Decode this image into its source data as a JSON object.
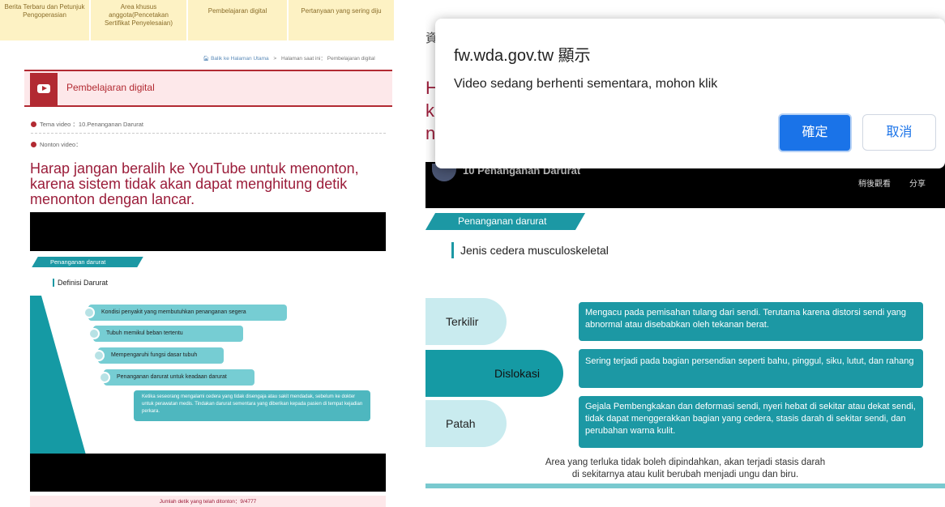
{
  "nav": [
    "Berita Terbaru dan Petunjuk Pengoperasian",
    "Area khusus anggota(Pencetakan Sertifikat Penyelesaian)",
    "Pembelajaran digital",
    "Pertanyaan yang sering diju"
  ],
  "breadcrumb": {
    "home": "Balik ke Halaman Utama",
    "separator": ">",
    "current": "Halaman saat ini： Pembelajaran digital"
  },
  "header_title": "Pembelajaran digital",
  "theme_label": "Tema video ：10.Penanganan Darurat",
  "watch_label": "Nonton video：",
  "warning": "Harap jangan beralih ke YouTube untuk menonton, karena sistem tidak akan dapat menghitung detik menonton dengan lancar.",
  "left_slide": {
    "banner": "Penanganan darurat",
    "heading": "Definisi Darurat",
    "items": [
      "Kondisi penyakit yang membutuhkan penanganan segera",
      "Tubuh memikul beban tertentu",
      "Mempengaruhi fungsi dasar tubuh",
      "Penanganan darurat untuk keadaan darurat"
    ],
    "detail": "Ketika seseorang mengalami cedera yang tidak disengaja atau sakit mendadak, sebelum ke dokter untuk perawatan medis. Tindakan darurat sementara yang diberikan kepada pasien di tempat kejadian perkara."
  },
  "seconds_counter": "Jumlah detik yang telah ditonton：9/4777",
  "right_bg_letters": [
    "H",
    "k",
    "n"
  ],
  "right_bg_top_char": "資",
  "youtube": {
    "title": "10 Penanganan Darurat",
    "watch_later": "稍後觀看",
    "share": "分享"
  },
  "right_slide": {
    "banner": "Penanganan darurat",
    "heading": "Jenis cedera musculoskeletal",
    "rows": [
      {
        "label": "Terkilir",
        "text": "Mengacu pada pemisahan tulang dari sendi.  Terutama karena distorsi sendi yang abnormal atau disebabkan oleh tekanan berat."
      },
      {
        "label": "Dislokasi",
        "text": "Sering terjadi pada bagian persendian seperti bahu, pinggul, siku, lutut, dan rahang"
      },
      {
        "label": "Patah",
        "text": "Gejala Pembengkakan dan deformasi sendi, nyeri hebat di sekitar atau dekat sendi, tidak dapat menggerakkan bagian yang cedera, stasis darah di sekitar sendi, dan perubahan warna kulit."
      }
    ],
    "note_line1": "Area yang terluka tidak boleh dipindahkan, akan terjadi stasis darah",
    "note_line2": "di sekitarnya atau kulit berubah menjadi ungu dan biru."
  },
  "dialog": {
    "title": "fw.wda.gov.tw 顯示",
    "message": "Video sedang berhenti sementara, mohon klik",
    "ok": "確定",
    "cancel": "取消"
  }
}
